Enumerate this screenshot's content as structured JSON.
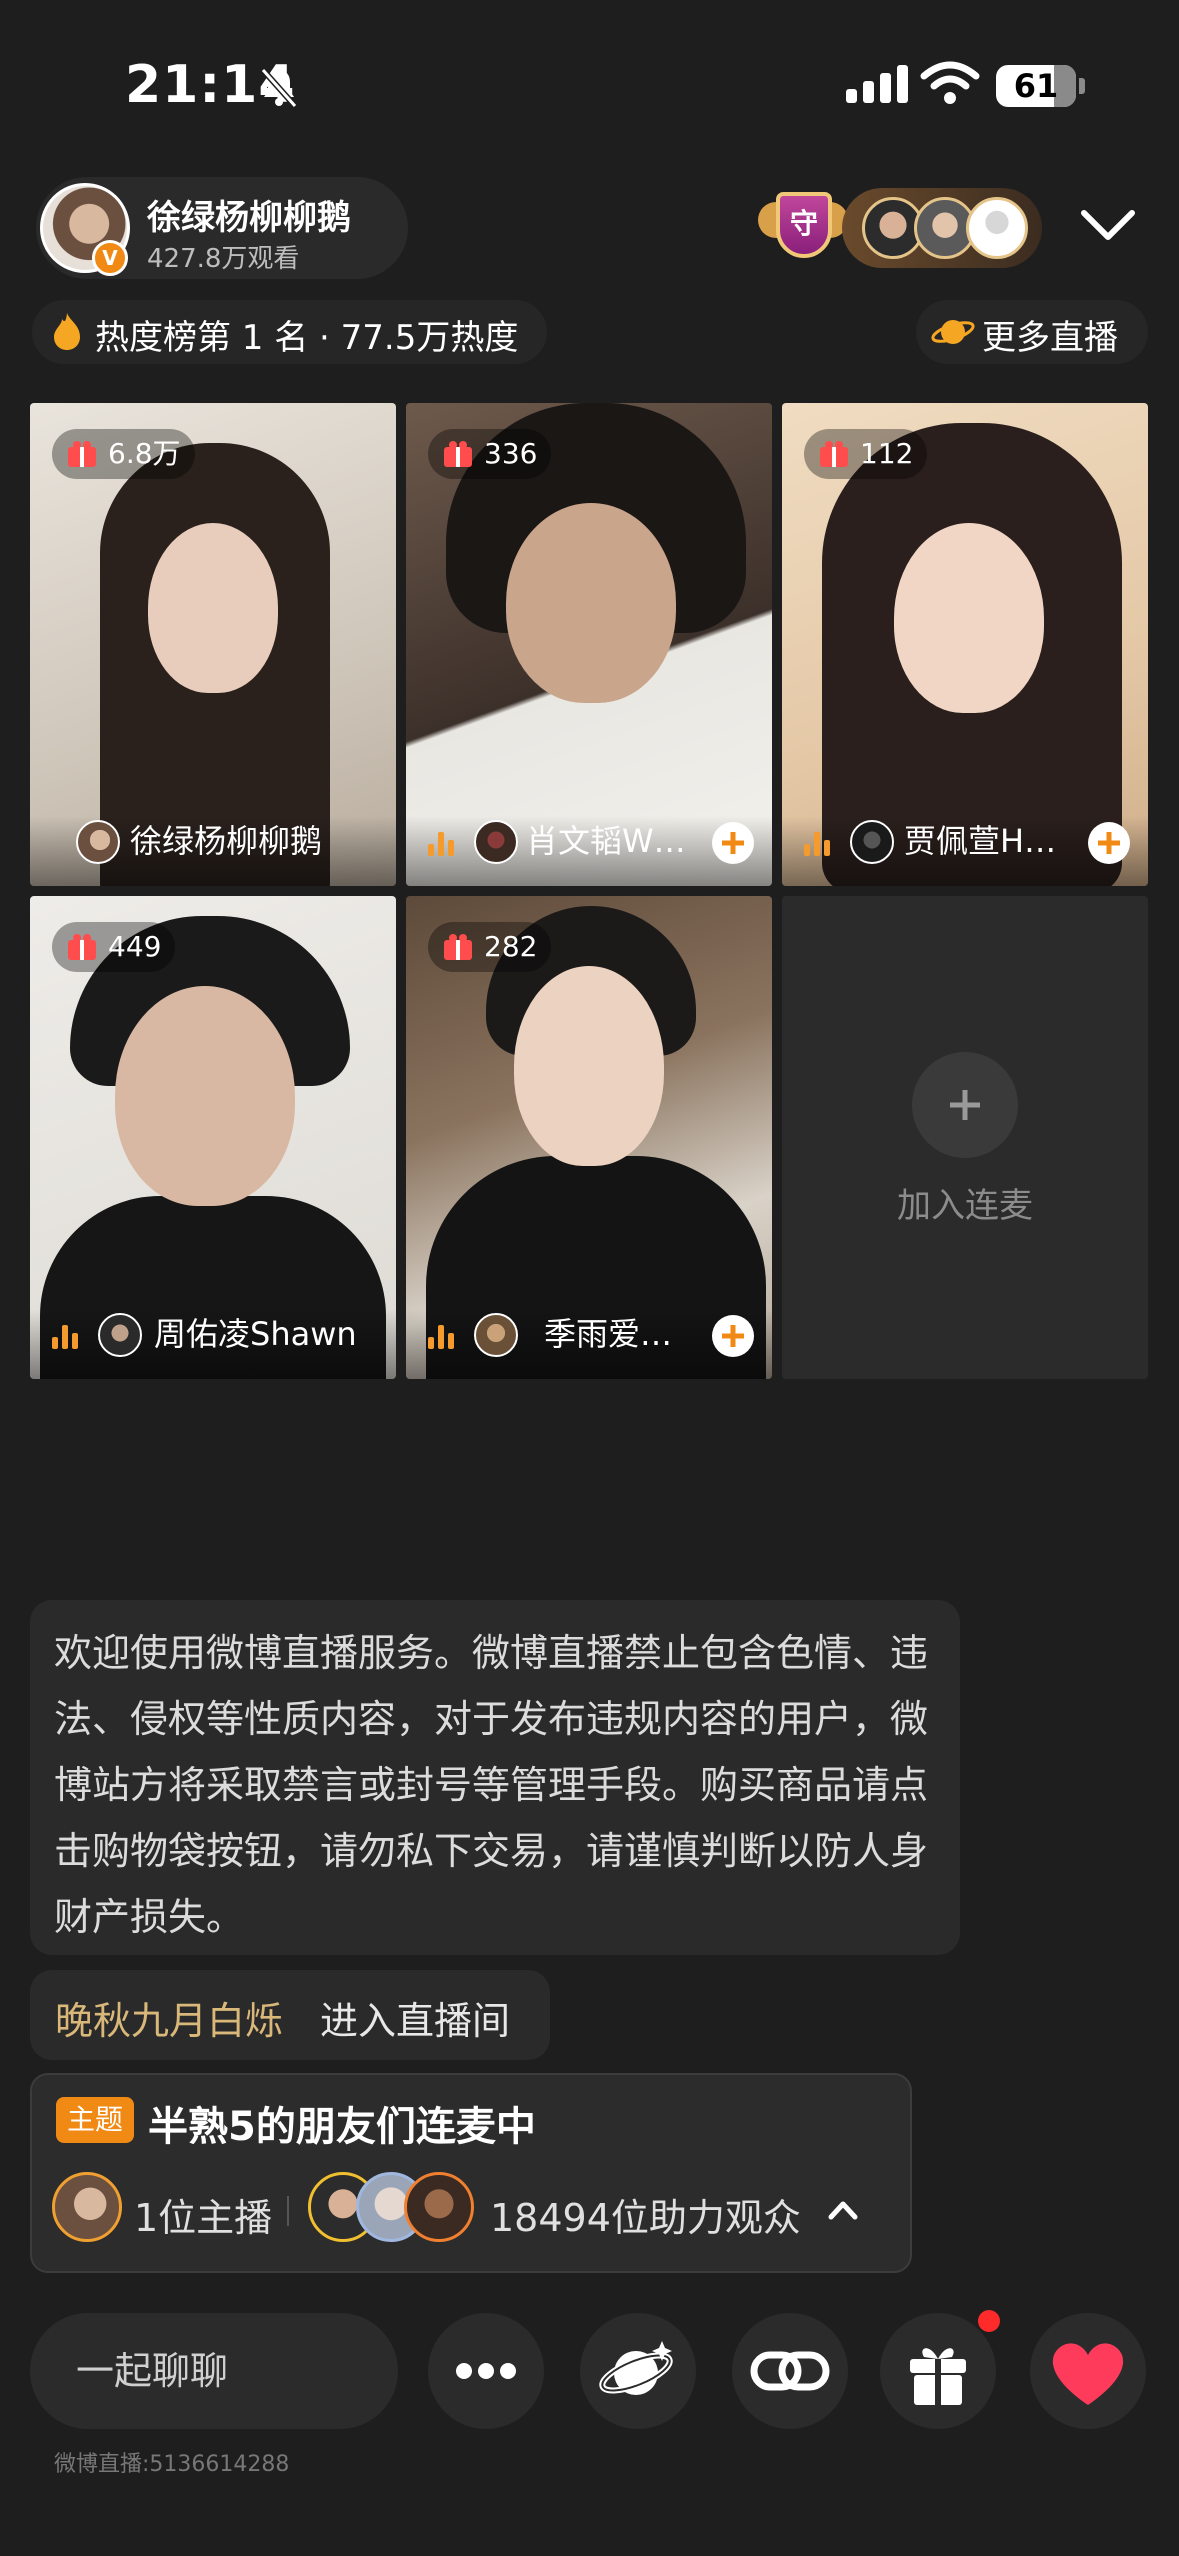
{
  "status_bar": {
    "time": "21:14",
    "battery": "61"
  },
  "host": {
    "name": "徐绿杨柳柳鹅",
    "views": "427.8万观看",
    "guard_badge": "守"
  },
  "hot": {
    "rank_text": "热度榜第 1 名 · 77.5万热度",
    "more_label": "更多直播"
  },
  "grid": [
    {
      "gifts": "6.8万",
      "name": "徐绿杨柳柳鹅"
    },
    {
      "gifts": "336",
      "name": "肖文韬W…"
    },
    {
      "gifts": "112",
      "name": "贾佩萱H…"
    },
    {
      "gifts": "449",
      "name": "周佑凌Shawn"
    },
    {
      "gifts": "282",
      "name": "季雨爱…"
    }
  ],
  "join": {
    "label": "加入连麦"
  },
  "notice": "欢迎使用微博直播服务。微博直播禁止包含色情、违法、侵权等性质内容，对于发布违规内容的用户，微博站方将采取禁言或封号等管理手段。购买商品请点击购物袋按钮，请勿私下交易，请谨慎判断以防人身财产损失。",
  "enter": {
    "user": "晚秋九月白烁",
    "text": "进入直播间"
  },
  "topic": {
    "tag": "主题",
    "title": "半熟5的朋友们连麦中",
    "hosts": "1位主播",
    "audience": "18494位助力观众"
  },
  "bottom": {
    "chat_placeholder": "一起聊聊"
  },
  "footer_id": "微博直播:5136614288",
  "colors": {
    "accent": "#f08a14",
    "background": "#1e1e1e",
    "heart": "#ff3b5c"
  }
}
